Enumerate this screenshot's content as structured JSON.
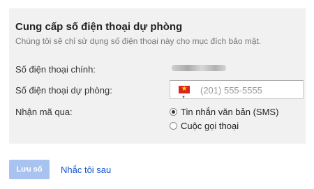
{
  "form": {
    "title": "Cung cấp số điện thoại dự phòng",
    "subtitle": "Chúng tôi sẽ chỉ sử dụng số điện thoại này cho mục đích bảo mật.",
    "primary_phone": {
      "label": "Số điện thoại chính:"
    },
    "backup_phone": {
      "label": "Số điện thoại dự phòng:",
      "placeholder": "(201) 555-5555",
      "country_flag_icon": "vietnam-flag-icon"
    },
    "receive_via": {
      "label": "Nhận mã qua:",
      "options": [
        {
          "label": "Tin nhắn văn bản (SMS)",
          "checked": true
        },
        {
          "label": "Cuộc gọi thoại",
          "checked": false
        }
      ]
    }
  },
  "actions": {
    "save_label": "Lưu số",
    "remind_later_label": "Nhắc tôi sau"
  },
  "colors": {
    "panel_background": "#f1f1f1",
    "save_button_background": "#a8c3ef",
    "link": "#1155cc",
    "flag_red": "#da251d",
    "flag_star": "#ffde00"
  }
}
